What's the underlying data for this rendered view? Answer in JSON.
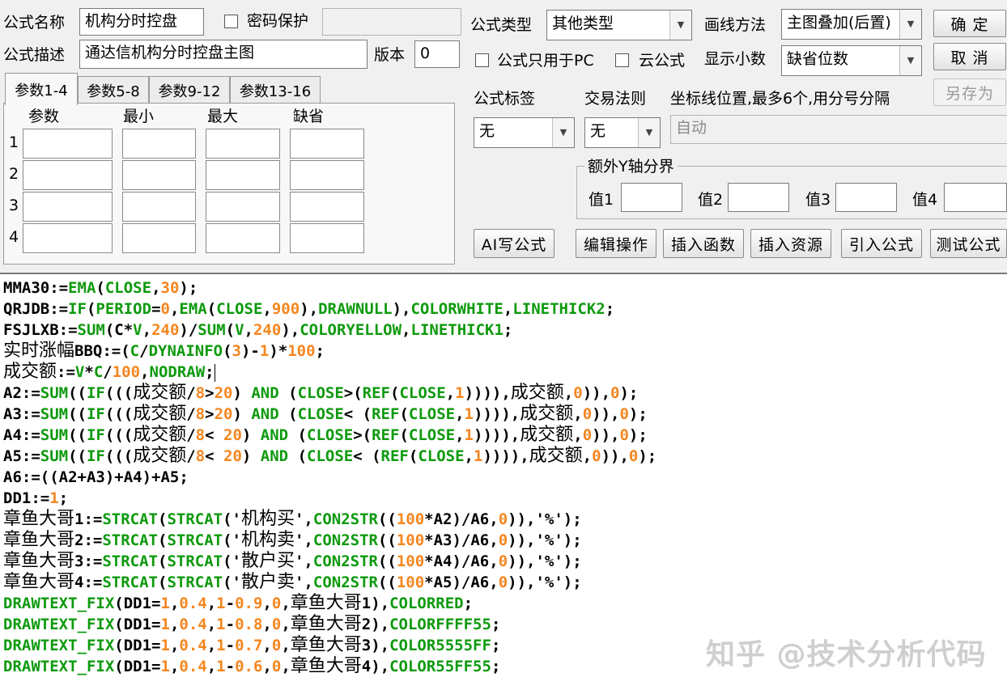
{
  "formula": {
    "name_label": "公式名称",
    "name_value": "机构分时控盘",
    "password_label": "密码保护",
    "desc_label": "公式描述",
    "desc_value": "通达信机构分时控盘主图",
    "version_label": "版本",
    "version_value": "0",
    "type_label": "公式类型",
    "type_value": "其他类型",
    "draw_label": "画线方法",
    "draw_value": "主图叠加(后置)",
    "pc_only_label": "公式只用于PC",
    "cloud_label": "云公式",
    "decimals_label": "显示小数",
    "decimals_value": "缺省位数"
  },
  "buttons": {
    "ok": "确  定",
    "cancel": "取  消",
    "save_as": "另存为",
    "ai_write": "AI写公式",
    "edit_ops": "编辑操作",
    "insert_func": "插入函数",
    "insert_res": "插入资源",
    "import": "引入公式",
    "test": "测试公式"
  },
  "tabs": [
    "参数1-4",
    "参数5-8",
    "参数9-12",
    "参数13-16"
  ],
  "params": {
    "headers": [
      "参数",
      "最小",
      "最大",
      "缺省"
    ],
    "rows": [
      "1",
      "2",
      "3",
      "4"
    ]
  },
  "tags": {
    "tag_label": "公式标签",
    "tag_value": "无",
    "trade_label": "交易法则",
    "trade_value": "无",
    "coord_label": "坐标线位置,最多6个,用分号分隔",
    "coord_value": "自动",
    "yaxis_legend": "额外Y轴分界",
    "v1": "值1",
    "v2": "值2",
    "v3": "值3",
    "v4": "值4"
  },
  "code": [
    [
      [
        "k",
        "MMA30:="
      ],
      [
        "g",
        "EMA"
      ],
      [
        "k",
        "("
      ],
      [
        "g",
        "CLOSE"
      ],
      [
        "k",
        ","
      ],
      [
        "o",
        "30"
      ],
      [
        "k",
        ");"
      ]
    ],
    [
      [
        "k",
        "QRJDB:="
      ],
      [
        "g",
        "IF"
      ],
      [
        "k",
        "("
      ],
      [
        "g",
        "PERIOD"
      ],
      [
        "k",
        "="
      ],
      [
        "o",
        "0"
      ],
      [
        "k",
        ","
      ],
      [
        "g",
        "EMA"
      ],
      [
        "k",
        "("
      ],
      [
        "g",
        "CLOSE"
      ],
      [
        "k",
        ","
      ],
      [
        "o",
        "900"
      ],
      [
        "k",
        "),"
      ],
      [
        "g",
        "DRAWNULL"
      ],
      [
        "k",
        "),"
      ],
      [
        "g",
        "COLORWHITE"
      ],
      [
        "k",
        ","
      ],
      [
        "g",
        "LINETHICK2"
      ],
      [
        "k",
        ";"
      ]
    ],
    [
      [
        "k",
        "FSJLXB:="
      ],
      [
        "g",
        "SUM"
      ],
      [
        "k",
        "(C*"
      ],
      [
        "g",
        "V"
      ],
      [
        "k",
        ","
      ],
      [
        "o",
        "240"
      ],
      [
        "k",
        ")/"
      ],
      [
        "g",
        "SUM"
      ],
      [
        "k",
        "("
      ],
      [
        "g",
        "V"
      ],
      [
        "k",
        ","
      ],
      [
        "o",
        "240"
      ],
      [
        "k",
        "),"
      ],
      [
        "g",
        "COLORYELLOW"
      ],
      [
        "k",
        ","
      ],
      [
        "g",
        "LINETHICK1"
      ],
      [
        "k",
        ";"
      ]
    ],
    [
      [
        "c",
        "实时涨幅"
      ],
      [
        "k",
        "BBQ:=("
      ],
      [
        "g",
        "C"
      ],
      [
        "k",
        "/"
      ],
      [
        "g",
        "DYNAINFO"
      ],
      [
        "k",
        "("
      ],
      [
        "o",
        "3"
      ],
      [
        "k",
        ")-"
      ],
      [
        "o",
        "1"
      ],
      [
        "k",
        ")*"
      ],
      [
        "o",
        "100"
      ],
      [
        "k",
        ";"
      ]
    ],
    [
      [
        "c",
        "成交额"
      ],
      [
        "k",
        ":="
      ],
      [
        "g",
        "V"
      ],
      [
        "k",
        "*"
      ],
      [
        "g",
        "C"
      ],
      [
        "k",
        "/"
      ],
      [
        "o",
        "100"
      ],
      [
        "k",
        ","
      ],
      [
        "g",
        "NODRAW"
      ],
      [
        "k",
        ";"
      ]
    ],
    [
      [
        "k",
        "A2:="
      ],
      [
        "g",
        "SUM"
      ],
      [
        "k",
        "(("
      ],
      [
        "g",
        "IF"
      ],
      [
        "k",
        "((("
      ],
      [
        "c",
        "成交额"
      ],
      [
        "k",
        "/"
      ],
      [
        "o",
        "8"
      ],
      [
        "k",
        ">"
      ],
      [
        "o",
        "20"
      ],
      [
        "k",
        ") "
      ],
      [
        "g",
        "AND"
      ],
      [
        "k",
        " ("
      ],
      [
        "g",
        "CLOSE"
      ],
      [
        "k",
        ">("
      ],
      [
        "g",
        "REF"
      ],
      [
        "k",
        "("
      ],
      [
        "g",
        "CLOSE"
      ],
      [
        "k",
        ","
      ],
      [
        "o",
        "1"
      ],
      [
        "k",
        "))))"
      ],
      [
        "k",
        ","
      ],
      [
        "c",
        "成交额"
      ],
      [
        "k",
        ","
      ],
      [
        "o",
        "0"
      ],
      [
        "k",
        ")),"
      ],
      [
        "o",
        "0"
      ],
      [
        "k",
        ");"
      ]
    ],
    [
      [
        "k",
        "A3:="
      ],
      [
        "g",
        "SUM"
      ],
      [
        "k",
        "(("
      ],
      [
        "g",
        "IF"
      ],
      [
        "k",
        "((("
      ],
      [
        "c",
        "成交额"
      ],
      [
        "k",
        "/"
      ],
      [
        "o",
        "8"
      ],
      [
        "k",
        ">"
      ],
      [
        "o",
        "20"
      ],
      [
        "k",
        ") "
      ],
      [
        "g",
        "AND"
      ],
      [
        "k",
        " ("
      ],
      [
        "g",
        "CLOSE"
      ],
      [
        "k",
        "< ("
      ],
      [
        "g",
        "REF"
      ],
      [
        "k",
        "("
      ],
      [
        "g",
        "CLOSE"
      ],
      [
        "k",
        ","
      ],
      [
        "o",
        "1"
      ],
      [
        "k",
        "))))"
      ],
      [
        "k",
        ","
      ],
      [
        "c",
        "成交额"
      ],
      [
        "k",
        ","
      ],
      [
        "o",
        "0"
      ],
      [
        "k",
        ")),"
      ],
      [
        "o",
        "0"
      ],
      [
        "k",
        ");"
      ]
    ],
    [
      [
        "k",
        "A4:="
      ],
      [
        "g",
        "SUM"
      ],
      [
        "k",
        "(("
      ],
      [
        "g",
        "IF"
      ],
      [
        "k",
        "((("
      ],
      [
        "c",
        "成交额"
      ],
      [
        "k",
        "/"
      ],
      [
        "o",
        "8"
      ],
      [
        "k",
        "< "
      ],
      [
        "o",
        "20"
      ],
      [
        "k",
        ") "
      ],
      [
        "g",
        "AND"
      ],
      [
        "k",
        " ("
      ],
      [
        "g",
        "CLOSE"
      ],
      [
        "k",
        ">("
      ],
      [
        "g",
        "REF"
      ],
      [
        "k",
        "("
      ],
      [
        "g",
        "CLOSE"
      ],
      [
        "k",
        ","
      ],
      [
        "o",
        "1"
      ],
      [
        "k",
        "))))"
      ],
      [
        "k",
        ","
      ],
      [
        "c",
        "成交额"
      ],
      [
        "k",
        ","
      ],
      [
        "o",
        "0"
      ],
      [
        "k",
        ")),"
      ],
      [
        "o",
        "0"
      ],
      [
        "k",
        ");"
      ]
    ],
    [
      [
        "k",
        "A5:="
      ],
      [
        "g",
        "SUM"
      ],
      [
        "k",
        "(("
      ],
      [
        "g",
        "IF"
      ],
      [
        "k",
        "((("
      ],
      [
        "c",
        "成交额"
      ],
      [
        "k",
        "/"
      ],
      [
        "o",
        "8"
      ],
      [
        "k",
        "< "
      ],
      [
        "o",
        "20"
      ],
      [
        "k",
        ") "
      ],
      [
        "g",
        "AND"
      ],
      [
        "k",
        " ("
      ],
      [
        "g",
        "CLOSE"
      ],
      [
        "k",
        "< ("
      ],
      [
        "g",
        "REF"
      ],
      [
        "k",
        "("
      ],
      [
        "g",
        "CLOSE"
      ],
      [
        "k",
        ","
      ],
      [
        "o",
        "1"
      ],
      [
        "k",
        "))))"
      ],
      [
        "k",
        ","
      ],
      [
        "c",
        "成交额"
      ],
      [
        "k",
        ","
      ],
      [
        "o",
        "0"
      ],
      [
        "k",
        ")),"
      ],
      [
        "o",
        "0"
      ],
      [
        "k",
        ");"
      ]
    ],
    [
      [
        "k",
        "A6:=((A2+A3)+A4)+A5;"
      ]
    ],
    [
      [
        "k",
        "DD1:="
      ],
      [
        "o",
        "1"
      ],
      [
        "k",
        ";"
      ]
    ],
    [
      [
        "c",
        "章鱼大哥"
      ],
      [
        "k",
        "1:="
      ],
      [
        "g",
        "STRCAT"
      ],
      [
        "k",
        "("
      ],
      [
        "g",
        "STRCAT"
      ],
      [
        "k",
        "('"
      ],
      [
        "c",
        "机构买"
      ],
      [
        "k",
        "',"
      ],
      [
        "g",
        "CON2STR"
      ],
      [
        "k",
        "(("
      ],
      [
        "o",
        "100"
      ],
      [
        "k",
        "*A2)/A6,"
      ],
      [
        "o",
        "0"
      ],
      [
        "k",
        ")),'%');"
      ]
    ],
    [
      [
        "c",
        "章鱼大哥"
      ],
      [
        "k",
        "2:="
      ],
      [
        "g",
        "STRCAT"
      ],
      [
        "k",
        "("
      ],
      [
        "g",
        "STRCAT"
      ],
      [
        "k",
        "('"
      ],
      [
        "c",
        "机构卖"
      ],
      [
        "k",
        "',"
      ],
      [
        "g",
        "CON2STR"
      ],
      [
        "k",
        "(("
      ],
      [
        "o",
        "100"
      ],
      [
        "k",
        "*A3)/A6,"
      ],
      [
        "o",
        "0"
      ],
      [
        "k",
        ")),'%');"
      ]
    ],
    [
      [
        "c",
        "章鱼大哥"
      ],
      [
        "k",
        "3:="
      ],
      [
        "g",
        "STRCAT"
      ],
      [
        "k",
        "("
      ],
      [
        "g",
        "STRCAT"
      ],
      [
        "k",
        "('"
      ],
      [
        "c",
        "散户买"
      ],
      [
        "k",
        "',"
      ],
      [
        "g",
        "CON2STR"
      ],
      [
        "k",
        "(("
      ],
      [
        "o",
        "100"
      ],
      [
        "k",
        "*A4)/A6,"
      ],
      [
        "o",
        "0"
      ],
      [
        "k",
        ")),'%');"
      ]
    ],
    [
      [
        "c",
        "章鱼大哥"
      ],
      [
        "k",
        "4:="
      ],
      [
        "g",
        "STRCAT"
      ],
      [
        "k",
        "("
      ],
      [
        "g",
        "STRCAT"
      ],
      [
        "k",
        "('"
      ],
      [
        "c",
        "散户卖"
      ],
      [
        "k",
        "',"
      ],
      [
        "g",
        "CON2STR"
      ],
      [
        "k",
        "(("
      ],
      [
        "o",
        "100"
      ],
      [
        "k",
        "*A5)/A6,"
      ],
      [
        "o",
        "0"
      ],
      [
        "k",
        ")),'%');"
      ]
    ],
    [
      [
        "g",
        "DRAWTEXT_FIX"
      ],
      [
        "k",
        "(DD1="
      ],
      [
        "o",
        "1"
      ],
      [
        "k",
        ","
      ],
      [
        "o",
        "0.4"
      ],
      [
        "k",
        ","
      ],
      [
        "o",
        "1"
      ],
      [
        "k",
        "-"
      ],
      [
        "o",
        "0.9"
      ],
      [
        "k",
        ","
      ],
      [
        "o",
        "0"
      ],
      [
        "k",
        ","
      ],
      [
        "c",
        "章鱼大哥"
      ],
      [
        "k",
        "1),"
      ],
      [
        "g",
        "COLORRED"
      ],
      [
        "k",
        ";"
      ]
    ],
    [
      [
        "g",
        "DRAWTEXT_FIX"
      ],
      [
        "k",
        "(DD1="
      ],
      [
        "o",
        "1"
      ],
      [
        "k",
        ","
      ],
      [
        "o",
        "0.4"
      ],
      [
        "k",
        ","
      ],
      [
        "o",
        "1"
      ],
      [
        "k",
        "-"
      ],
      [
        "o",
        "0.8"
      ],
      [
        "k",
        ","
      ],
      [
        "o",
        "0"
      ],
      [
        "k",
        ","
      ],
      [
        "c",
        "章鱼大哥"
      ],
      [
        "k",
        "2),"
      ],
      [
        "g",
        "COLORFFFF55"
      ],
      [
        "k",
        ";"
      ]
    ],
    [
      [
        "g",
        "DRAWTEXT_FIX"
      ],
      [
        "k",
        "(DD1="
      ],
      [
        "o",
        "1"
      ],
      [
        "k",
        ","
      ],
      [
        "o",
        "0.4"
      ],
      [
        "k",
        ","
      ],
      [
        "o",
        "1"
      ],
      [
        "k",
        "-"
      ],
      [
        "o",
        "0.7"
      ],
      [
        "k",
        ","
      ],
      [
        "o",
        "0"
      ],
      [
        "k",
        ","
      ],
      [
        "c",
        "章鱼大哥"
      ],
      [
        "k",
        "3),"
      ],
      [
        "g",
        "COLOR5555FF"
      ],
      [
        "k",
        ";"
      ]
    ],
    [
      [
        "g",
        "DRAWTEXT_FIX"
      ],
      [
        "k",
        "(DD1="
      ],
      [
        "o",
        "1"
      ],
      [
        "k",
        ","
      ],
      [
        "o",
        "0.4"
      ],
      [
        "k",
        ","
      ],
      [
        "o",
        "1"
      ],
      [
        "k",
        "-"
      ],
      [
        "o",
        "0.6"
      ],
      [
        "k",
        ","
      ],
      [
        "o",
        "0"
      ],
      [
        "k",
        ","
      ],
      [
        "c",
        "章鱼大哥"
      ],
      [
        "k",
        "4),"
      ],
      [
        "g",
        "COLOR55FF55"
      ],
      [
        "k",
        ";"
      ]
    ]
  ],
  "colors": {
    "keyword": "#0e9a0e",
    "number": "#f5861f"
  },
  "watermark": "知乎 @技术分析代码"
}
